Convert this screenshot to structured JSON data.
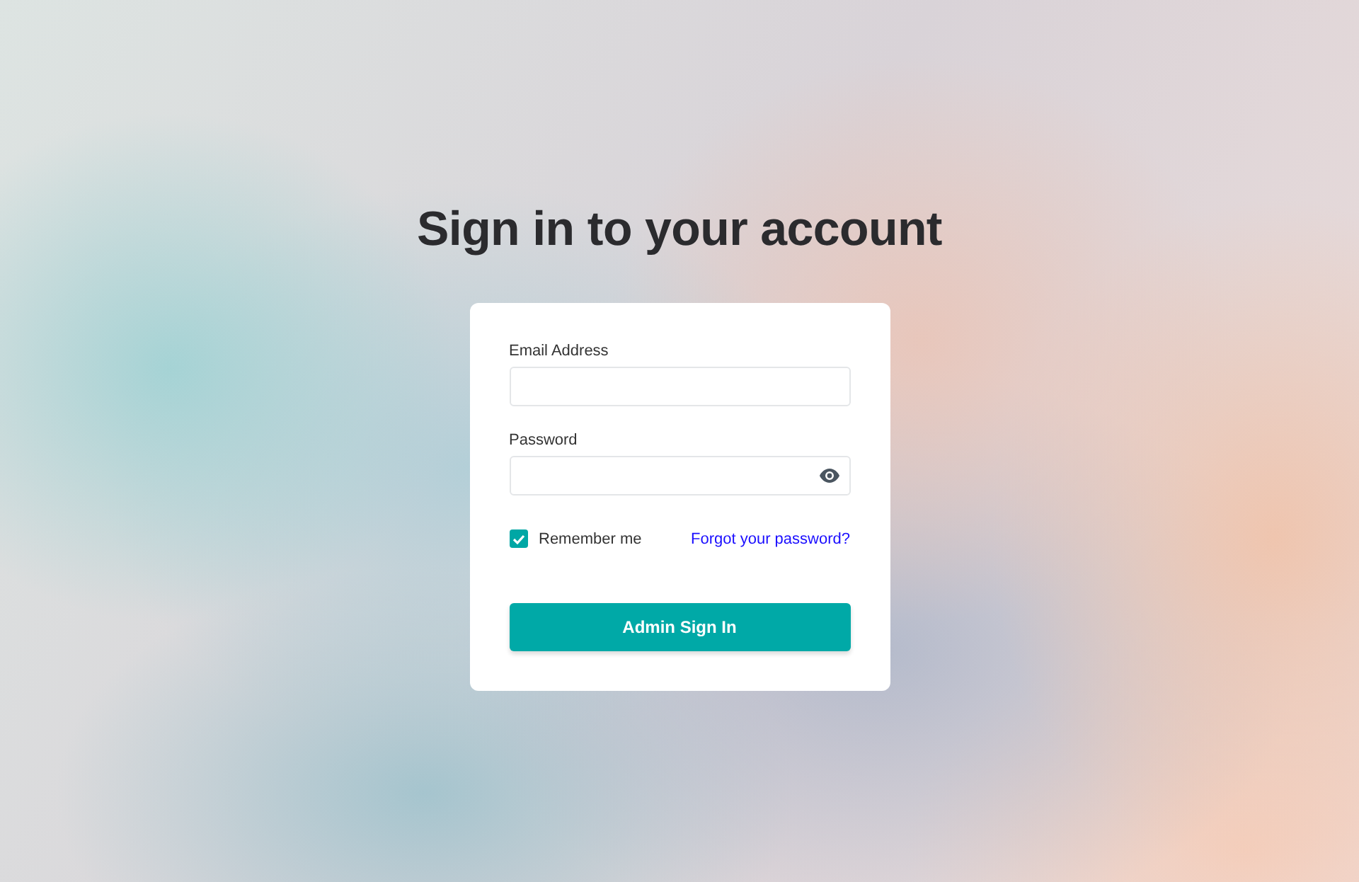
{
  "title": "Sign in to your account",
  "fields": [
    {
      "label": "Email Address",
      "kind": "text"
    },
    {
      "label": "Password",
      "kind": "password"
    }
  ],
  "remember": {
    "label": "Remember me",
    "checked": true
  },
  "forgot_link": "Forgot your password?",
  "submit_button": "Admin Sign In"
}
